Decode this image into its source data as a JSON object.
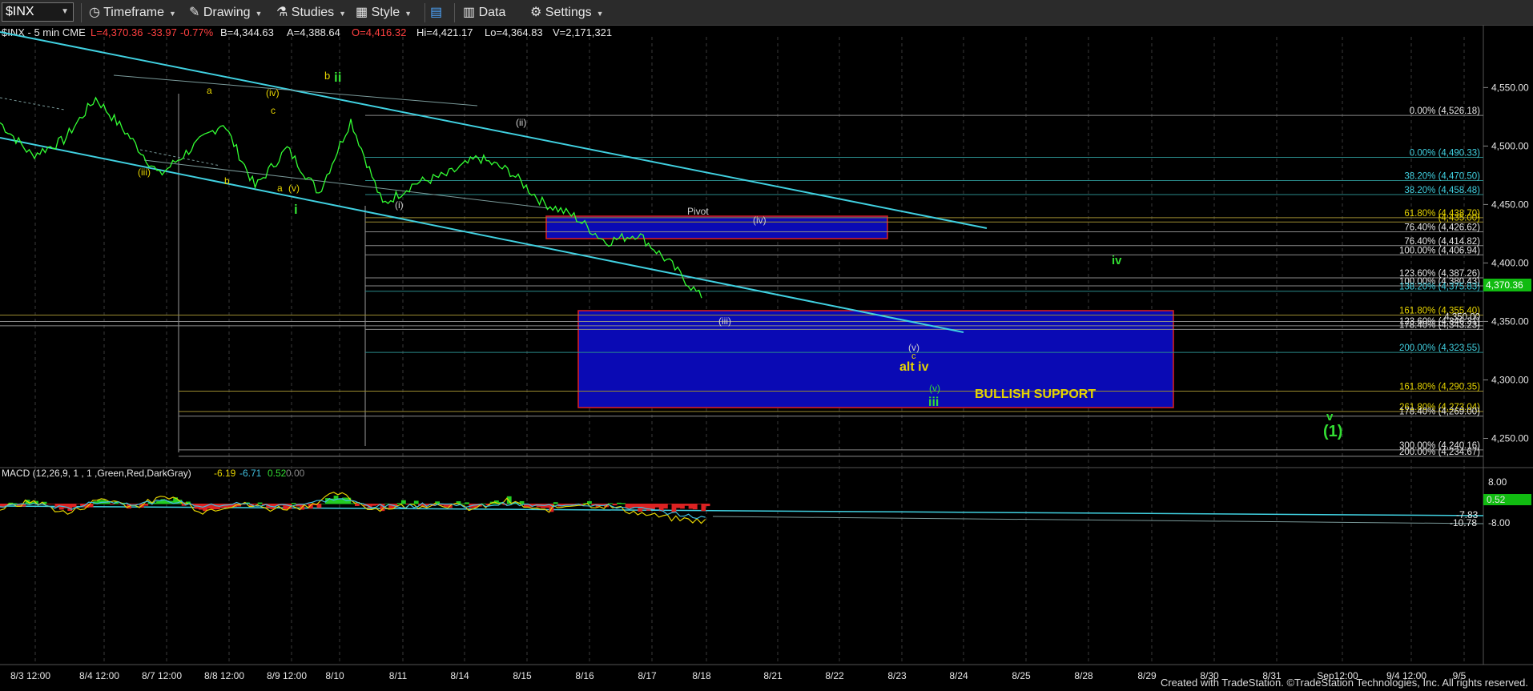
{
  "toolbar": {
    "symbol": "$INX",
    "timeframe_label": "Timeframe",
    "drawing_label": "Drawing",
    "studies_label": "Studies",
    "style_label": "Style",
    "data_label": "Data",
    "settings_label": "Settings"
  },
  "header": {
    "symbol_info": "$INX - 5 min  CME",
    "last": "L=4,370.36",
    "change": "-33.97",
    "change_pct": "-0.77%",
    "bid": "B=4,344.63",
    "ask": "A=4,388.64",
    "open": "O=4,416.32",
    "high": "Hi=4,421.17",
    "low": "Lo=4,364.83",
    "volume": "V=2,171,321"
  },
  "colors": {
    "price": "#33ff33",
    "trendline": "#40d0e0",
    "fib": "#c8c8c8",
    "box_fill": "#0a0ab4",
    "box_border": "#e02020",
    "wave_green": "#33dd33",
    "wave_yellow": "#e6d400",
    "macd_hist_pos": "#22cc22",
    "macd_hist_neg": "#dd2222",
    "last_price_bg": "#11bb11"
  },
  "chart_data": [
    {
      "type": "line",
      "title": "$INX - 5 min",
      "y_axis": {
        "ticks": [
          4550,
          4500,
          4450,
          4400,
          4350,
          4300,
          4250
        ],
        "tick_labels": [
          "4,550.00",
          "4,500.00",
          "4,450.00",
          "4,400.00",
          "4,350.00",
          "4,300.00",
          "4,250.00"
        ],
        "ylim": [
          4225,
          4592
        ]
      },
      "x_axis": {
        "ticks": [
          "8/3 12:00",
          "8/4 12:00",
          "8/7 12:00",
          "8/8 12:00",
          "8/9 12:00",
          "8/10",
          "8/11",
          "8/14",
          "8/15",
          "8/16",
          "8/17",
          "8/18",
          "8/21",
          "8/22",
          "8/23",
          "8/24",
          "8/25",
          "8/28",
          "8/29",
          "8/30",
          "8/31",
          "Sep12:00",
          "9/4 12:00",
          "9/5"
        ]
      },
      "series": [
        {
          "x": [
            "8/3",
            "8/3 12:00",
            "8/4",
            "8/4 12:00",
            "8/7",
            "8/7 12:00",
            "8/8",
            "8/8 12:00",
            "8/9",
            "8/9 12:00",
            "8/10",
            "8/10 12:00",
            "8/11",
            "8/11 12:00",
            "8/14",
            "8/14 12:00",
            "8/15",
            "8/15 12:00",
            "8/16",
            "8/16 12:00",
            "8/17",
            "8/17 12:00",
            "8/18"
          ],
          "values": [
            4520,
            4492,
            4505,
            4541,
            4510,
            4475,
            4498,
            4520,
            4465,
            4498,
            4460,
            4522,
            4450,
            4468,
            4475,
            4490,
            4478,
            4452,
            4440,
            4418,
            4425,
            4400,
            4370
          ]
        }
      ],
      "last_price_label": "4,370.36",
      "fib_levels": [
        {
          "label": "0.00% (4,526.18)",
          "value": 4526.18
        },
        {
          "label": "0.00% (4,490.33)",
          "value": 4490.33
        },
        {
          "label": "38.20% (4,470.50)",
          "value": 4470.5
        },
        {
          "label": "38.20% (4,458.48)",
          "value": 4458.48
        },
        {
          "label": "61.80% (4,438.70)",
          "value": 4438.7
        },
        {
          "label": "(4,435.00)",
          "value": 4435.0
        },
        {
          "label": "76.40% (4,426.62)",
          "value": 4426.62
        },
        {
          "label": "76.40% (4,414.82)",
          "value": 4414.82
        },
        {
          "label": "100.00% (4,406.94)",
          "value": 4406.94
        },
        {
          "label": "123.60% (4,387.26)",
          "value": 4387.26
        },
        {
          "label": "100.00% (4,380.43)",
          "value": 4380.43
        },
        {
          "label": "138.20% (4,375.83)",
          "value": 4375.83
        },
        {
          "label": "161.80% (4,355.40)",
          "value": 4355.4
        },
        {
          "label": "4,350.00",
          "value": 4350.0
        },
        {
          "label": "123.60% (4,346.31)",
          "value": 4346.31
        },
        {
          "label": "178.40% (4,343.23)",
          "value": 4343.23
        },
        {
          "label": "200.00% (4,323.55)",
          "value": 4323.55
        },
        {
          "label": "161.80% (4,290.35)",
          "value": 4290.35
        },
        {
          "label": "261.80% (4,273.04)",
          "value": 4273.04
        },
        {
          "label": "178.40% (4,269.00)",
          "value": 4269.0
        },
        {
          "label": "300.00% (4,240.16)",
          "value": 4240.16
        },
        {
          "label": "200.00% (4,234.67)",
          "value": 4234.67
        }
      ],
      "annotations": [
        "b",
        "ii",
        "a",
        "(iv)",
        "c",
        "(iii)",
        "b",
        "a",
        "(v)",
        "i",
        "(ii)",
        "(i)",
        "Pivot",
        "(iv)",
        "(iii)",
        "iv",
        "(v)",
        "c",
        "alt iv",
        "(v)",
        "iii",
        "BULLISH SUPPORT",
        "v",
        "(1)"
      ]
    },
    {
      "type": "line",
      "title": "MACD (12,26,9, 1 , 1 ,Green,Red,DarkGray)",
      "legend_values": [
        "-6.19",
        "-6.71",
        "0.52",
        "0.00"
      ],
      "y_axis": {
        "ticks": [
          8,
          -8
        ],
        "tick_labels": [
          "8.00",
          "-8.00"
        ]
      },
      "value_labels": [
        "0.52",
        "-7.83",
        "-10.78"
      ],
      "series": [
        {
          "name": "MACD",
          "values": [
            -2,
            1,
            -4,
            2,
            -1,
            3,
            -3,
            0,
            -2,
            -1,
            4,
            -2,
            -1,
            0,
            -2,
            1,
            -3,
            0,
            -1,
            -4,
            -6,
            -7
          ]
        },
        {
          "name": "Signal",
          "values": [
            -1,
            0,
            -2,
            1,
            0,
            1,
            -1,
            0,
            -1,
            0,
            2,
            -1,
            -1,
            0,
            -1,
            0,
            -1,
            0,
            -1,
            -2,
            -4,
            -6
          ]
        }
      ]
    }
  ],
  "footer": "Created with TradeStation. ©TradeStation Technologies, Inc. All rights reserved."
}
